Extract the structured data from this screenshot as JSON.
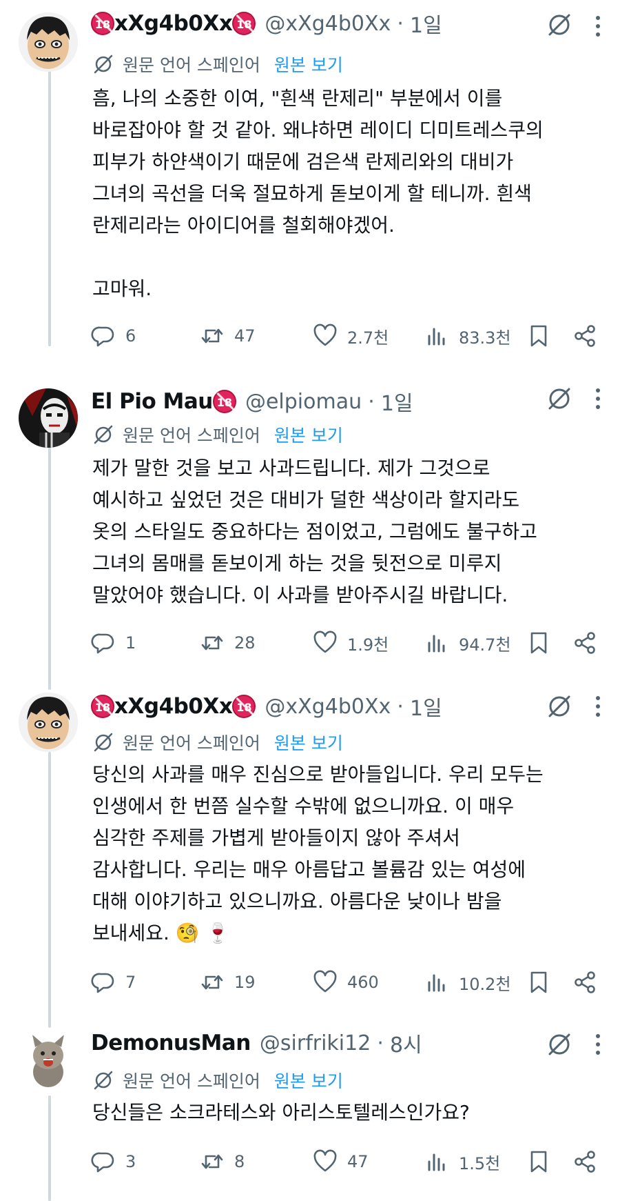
{
  "tweets": [
    {
      "name": "xXg4b0Xx",
      "handle": "@xXg4b0Xx",
      "time": "1일",
      "translate_label": "원문 언어 스페인어",
      "show_original": "원본 보기",
      "text": "흠, 나의 소중한 이여, \"흰색 란제리\" 부분에서 이를\n바로잡아야 할 것 같아. 왜냐하면 레이디 디미트레스쿠의\n피부가 하얀색이기 때문에 검은색 란제리와의 대비가\n그녀의 곡선을 더욱 절묘하게 돋보이게 할 테니까. 흰색\n란제리라는 아이디어를 철회해야겠어.\n\n고마워.",
      "replies": "6",
      "retweets": "47",
      "likes": "2.7천",
      "views": "83.3천"
    },
    {
      "name": "El Pio Mau",
      "handle": "@elpiomau",
      "time": "1일",
      "translate_label": "원문 언어 스페인어",
      "show_original": "원본 보기",
      "text": "제가 말한 것을 보고 사과드립니다. 제가 그것으로\n예시하고 싶었던 것은 대비가 덜한 색상이라 할지라도\n옷의 스타일도 중요하다는 점이었고, 그럼에도 불구하고\n그녀의 몸매를 돋보이게 하는 것을 뒷전으로 미루지\n말았어야 했습니다. 이 사과를 받아주시길 바랍니다.",
      "replies": "1",
      "retweets": "28",
      "likes": "1.9천",
      "views": "94.7천"
    },
    {
      "name": "xXg4b0Xx",
      "handle": "@xXg4b0Xx",
      "time": "1일",
      "translate_label": "원문 언어 스페인어",
      "show_original": "원본 보기",
      "text": "당신의 사과를 매우 진심으로 받아들입니다. 우리 모두는\n인생에서 한 번쯤 실수할 수밖에 없으니까요. 이 매우\n심각한 주제를 가볍게 받아들이지 않아 주셔서\n감사합니다. 우리는 매우 아름답고 볼륨감 있는 여성에\n대해 이야기하고 있으니까요. 아름다운 낮이나 밤을\n보내세요. 🧐 🍷",
      "replies": "7",
      "retweets": "19",
      "likes": "460",
      "views": "10.2천"
    },
    {
      "name": "DemonusMan",
      "handle": "@sirfriki12",
      "time": "8시",
      "translate_label": "원문 언어 스페인어",
      "show_original": "원본 보기",
      "text": "당신들은 소크라테스와 아리스토텔레스인가요?",
      "replies": "3",
      "retweets": "8",
      "likes": "47",
      "views": "1.5천"
    }
  ],
  "badge_text": "18",
  "icons": {
    "reply": "reply-icon",
    "retweet": "retweet-icon",
    "like": "heart-icon",
    "views": "views-icon",
    "bookmark": "bookmark-icon",
    "share": "share-icon",
    "grok": "grok-icon",
    "more": "more-icon",
    "translate": "translate-icon"
  },
  "colors": {
    "text": "#0f1419",
    "secondary": "#536471",
    "link": "#1d9bf0",
    "badge": "#e0245e",
    "thread_line": "#cfd9de"
  }
}
